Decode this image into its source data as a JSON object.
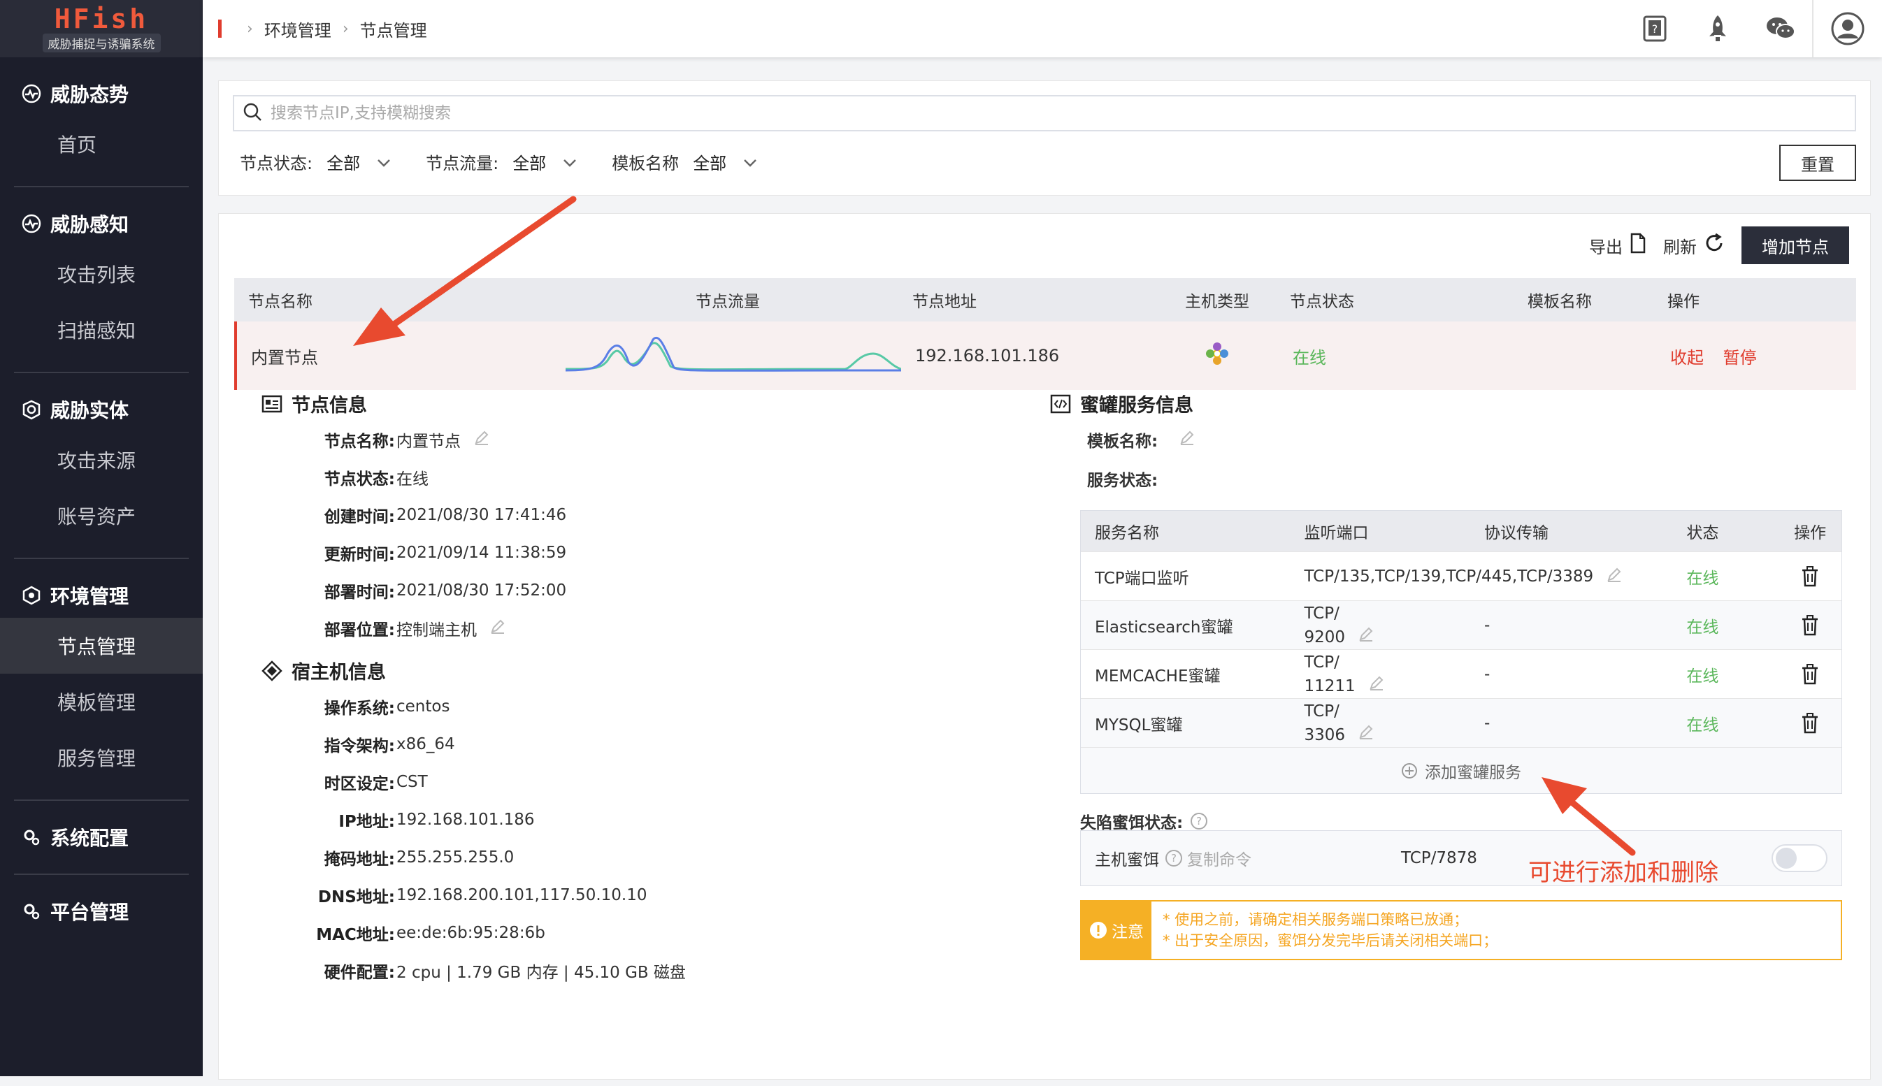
{
  "app": {
    "logo": "HFish",
    "subtitle": "威胁捕捉与诱骗系统"
  },
  "sidebar": {
    "sections": [
      {
        "title": "威胁态势",
        "icon": "dashboard-icon",
        "items": [
          "首页"
        ]
      },
      {
        "title": "威胁感知",
        "icon": "radar-icon",
        "items": [
          "攻击列表",
          "扫描感知"
        ]
      },
      {
        "title": "威胁实体",
        "icon": "shield-icon",
        "items": [
          "攻击来源",
          "账号资产"
        ]
      },
      {
        "title": "环境管理",
        "icon": "hexagon-icon",
        "items": [
          "节点管理",
          "模板管理",
          "服务管理"
        ],
        "active": "节点管理"
      },
      {
        "title": "系统配置",
        "icon": "gear-icon",
        "items": []
      },
      {
        "title": "平台管理",
        "icon": "gear-icon",
        "items": []
      }
    ]
  },
  "breadcrumb": [
    "环境管理",
    "节点管理"
  ],
  "filter": {
    "search_placeholder": "搜索节点IP,支持模糊搜索",
    "status_label": "节点状态:",
    "status_value": "全部",
    "traffic_label": "节点流量:",
    "traffic_value": "全部",
    "template_label": "模板名称",
    "template_value": "全部",
    "reset": "重置"
  },
  "toolbar": {
    "export": "导出",
    "refresh": "刷新",
    "add_node": "增加节点"
  },
  "table": {
    "headers": [
      "节点名称",
      "节点流量",
      "节点地址",
      "主机类型",
      "节点状态",
      "模板名称",
      "操作"
    ],
    "row": {
      "name": "内置节点",
      "address": "192.168.101.186",
      "status": "在线",
      "collapse": "收起",
      "pause": "暂停"
    }
  },
  "node_info": {
    "title": "节点信息",
    "fields": [
      {
        "k": "节点名称:",
        "v": "内置节点"
      },
      {
        "k": "节点状态:",
        "v": "在线"
      },
      {
        "k": "创建时间:",
        "v": "2021/08/30 17:41:46"
      },
      {
        "k": "更新时间:",
        "v": "2021/09/14 11:38:59"
      },
      {
        "k": "部署时间:",
        "v": "2021/08/30 17:52:00"
      },
      {
        "k": "部署位置:",
        "v": "控制端主机"
      }
    ]
  },
  "host_info": {
    "title": "宿主机信息",
    "fields": [
      {
        "k": "操作系统:",
        "v": "centos"
      },
      {
        "k": "指令架构:",
        "v": "x86_64"
      },
      {
        "k": "时区设定:",
        "v": "CST"
      },
      {
        "k": "IP地址:",
        "v": "192.168.101.186"
      },
      {
        "k": "掩码地址:",
        "v": "255.255.255.0"
      },
      {
        "k": "DNS地址:",
        "v": "192.168.200.101,117.50.10.10"
      },
      {
        "k": "MAC地址:",
        "v": "ee:de:6b:95:28:6b"
      },
      {
        "k": "硬件配置:",
        "v": "2 cpu | 1.79 GB 内存 | 45.10 GB 磁盘"
      }
    ]
  },
  "honeypot": {
    "title": "蜜罐服务信息",
    "template_label": "模板名称:",
    "service_status_label": "服务状态:",
    "headers": [
      "服务名称",
      "监听端口",
      "协议传输",
      "状态",
      "操作"
    ],
    "rows": [
      {
        "name": "TCP端口监听",
        "port1": "TCP/135,TCP/139,TCP/445,TCP/3389",
        "port2": "",
        "proto": "",
        "status": "在线"
      },
      {
        "name": "Elasticsearch蜜罐",
        "port1": "TCP/",
        "port2": "9200",
        "proto": "-",
        "status": "在线"
      },
      {
        "name": "MEMCACHE蜜罐",
        "port1": "TCP/",
        "port2": "11211",
        "proto": "-",
        "status": "在线"
      },
      {
        "name": "MYSQL蜜罐",
        "port1": "TCP/",
        "port2": "3306",
        "proto": "-",
        "status": "在线"
      }
    ],
    "add_service": "添加蜜罐服务",
    "trap_status_label": "失陷蜜饵状态:",
    "trap_name": "主机蜜饵",
    "copy_command": "复制命令",
    "trap_port": "TCP/7878",
    "notice_tag": "注意",
    "notice_lines": [
      "* 使用之前，请确定相关服务端口策略已放通；",
      "* 出于安全原因，蜜饵分发完毕后请关闭相关端口；"
    ]
  },
  "annotation": "可进行添加和删除",
  "colors": {
    "accent": "#e03c2e",
    "online": "#5bb75b",
    "sidebar": "#1c1e2b",
    "notice": "#f5b025"
  }
}
